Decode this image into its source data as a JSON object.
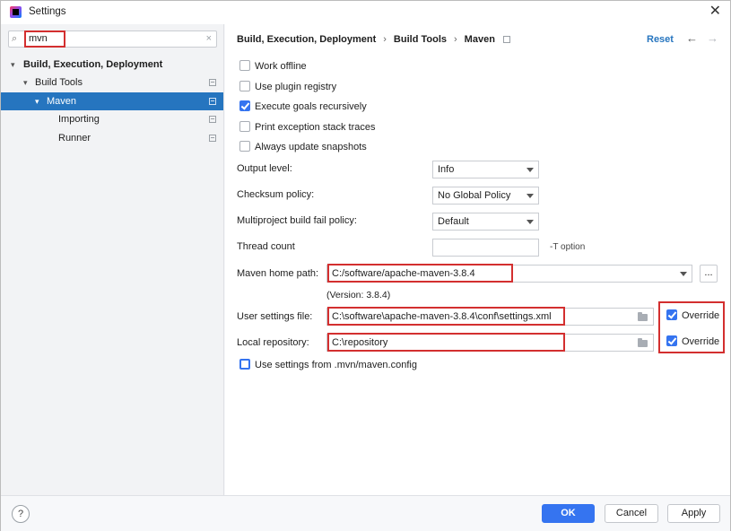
{
  "window": {
    "title": "Settings",
    "close_glyph": "✕"
  },
  "search": {
    "query": "mvn",
    "clear_glyph": "×",
    "search_glyph": "⌕"
  },
  "tree": {
    "root": "Build, Execution, Deployment",
    "build_tools": "Build Tools",
    "maven": "Maven",
    "importing": "Importing",
    "runner": "Runner"
  },
  "header": {
    "crumb1": "Build, Execution, Deployment",
    "crumb2": "Build Tools",
    "crumb3": "Maven",
    "sep": "›",
    "reset": "Reset",
    "back": "←",
    "forward": "→"
  },
  "options": {
    "work_offline": {
      "label": "Work offline",
      "checked": false
    },
    "plugin_registry": {
      "label": "Use plugin registry",
      "checked": false
    },
    "execute_recursive": {
      "label": "Execute goals recursively",
      "checked": true
    },
    "print_traces": {
      "label": "Print exception stack traces",
      "checked": false
    },
    "update_snapshots": {
      "label": "Always update snapshots",
      "checked": false
    }
  },
  "fields": {
    "output_level": {
      "label": "Output level:",
      "value": "Info"
    },
    "checksum_policy": {
      "label": "Checksum policy:",
      "value": "No Global Policy"
    },
    "fail_policy": {
      "label": "Multiproject build fail policy:",
      "value": "Default"
    },
    "thread_count": {
      "label": "Thread count",
      "value": "",
      "hint": "-T option"
    },
    "maven_home": {
      "label": "Maven home path:",
      "value": "C:/software/apache-maven-3.8.4",
      "version": "(Version: 3.8.4)",
      "browse": "..."
    },
    "user_settings": {
      "label": "User settings file:",
      "value": "C:\\software\\apache-maven-3.8.4\\conf\\settings.xml",
      "override": "Override",
      "override_checked": true
    },
    "local_repo": {
      "label": "Local repository:",
      "value": "C:\\repository",
      "override": "Override",
      "override_checked": true
    },
    "mvn_config": {
      "label": "Use settings from .mvn/maven.config",
      "checked": false
    }
  },
  "footer": {
    "help": "?",
    "ok": "OK",
    "cancel": "Cancel",
    "apply": "Apply"
  },
  "colors": {
    "accent": "#3574f0",
    "selection": "#2675bf",
    "highlight": "#d32f2f"
  }
}
